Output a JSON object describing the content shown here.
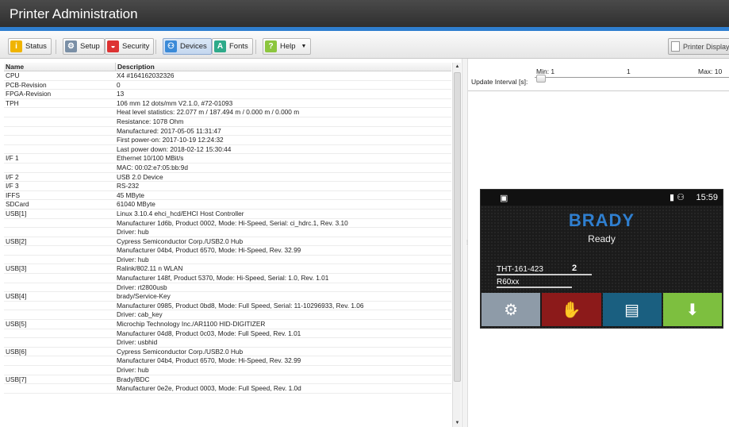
{
  "title": "Printer Administration",
  "toolbar": {
    "status": "Status",
    "setup": "Setup",
    "security": "Security",
    "devices": "Devices",
    "fonts": "Fonts",
    "help": "Help",
    "printer_display": "Printer Display"
  },
  "table": {
    "col_name": "Name",
    "col_desc": "Description",
    "rows": [
      [
        "CPU",
        "X4 #164162032326"
      ],
      [
        "PCB-Revision",
        "0"
      ],
      [
        "FPGA-Revision",
        "13"
      ],
      [
        "TPH",
        "106 mm 12 dots/mm V2.1.0, #72-01093"
      ],
      [
        "",
        "Heat level statistics: 22.077 m / 187.494 m / 0.000 m / 0.000 m"
      ],
      [
        "",
        "Resistance: 1078 Ohm"
      ],
      [
        "",
        "Manufactured: 2017-05-05 11:31:47"
      ],
      [
        "",
        "First power-on: 2017-10-19 12:24:32"
      ],
      [
        "",
        "Last power down: 2018-02-12 15:30:44"
      ],
      [
        "I/F 1",
        "Ethernet 10/100 MBit/s"
      ],
      [
        "",
        "MAC: 00:02:e7:05:bb:9d"
      ],
      [
        "I/F 2",
        "USB 2.0 Device"
      ],
      [
        "I/F 3",
        "RS-232"
      ],
      [
        "IFFS",
        "45 MByte"
      ],
      [
        "SDCard",
        "61040 MByte"
      ],
      [
        "USB[1]",
        "Linux 3.10.4 ehci_hcd/EHCI Host Controller"
      ],
      [
        "",
        "Manufacturer 1d6b, Product 0002, Mode: Hi-Speed, Serial: ci_hdrc.1, Rev. 3.10"
      ],
      [
        "",
        "Driver: hub"
      ],
      [
        "USB[2]",
        "Cypress Semiconductor Corp./USB2.0 Hub"
      ],
      [
        "",
        "Manufacturer 04b4, Product 6570, Mode: Hi-Speed, Rev. 32.99"
      ],
      [
        "",
        "Driver: hub"
      ],
      [
        "USB[3]",
        "Ralink/802.11 n WLAN"
      ],
      [
        "",
        "Manufacturer 148f, Product 5370, Mode: Hi-Speed, Serial: 1.0, Rev. 1.01"
      ],
      [
        "",
        "Driver: rt2800usb"
      ],
      [
        "USB[4]",
        "brady/Service-Key"
      ],
      [
        "",
        "Manufacturer 0985, Product 0bd8, Mode: Full Speed, Serial: 11-10296933, Rev. 1.06"
      ],
      [
        "",
        "Driver: cab_key"
      ],
      [
        "USB[5]",
        "Microchip Technology Inc./AR1100 HID-DIGITIZER"
      ],
      [
        "",
        "Manufacturer 04d8, Product 0c03, Mode: Full Speed, Rev. 1.01"
      ],
      [
        "",
        "Driver: usbhid"
      ],
      [
        "USB[6]",
        "Cypress Semiconductor Corp./USB2.0 Hub"
      ],
      [
        "",
        "Manufacturer 04b4, Product 6570, Mode: Hi-Speed, Rev. 32.99"
      ],
      [
        "",
        "Driver: hub"
      ],
      [
        "USB[7]",
        "Brady/BDC"
      ],
      [
        "",
        "Manufacturer 0e2e, Product 0003, Mode: Full Speed, Rev. 1.0d"
      ]
    ]
  },
  "update": {
    "label": "Update Interval [s]:",
    "min": "Min: 1",
    "current": "1",
    "max": "Max: 10"
  },
  "display": {
    "time": "15:59",
    "brand": "BRADY",
    "status": "Ready",
    "label1": "THT-161-423",
    "count": "2",
    "label2": "R60xx"
  }
}
